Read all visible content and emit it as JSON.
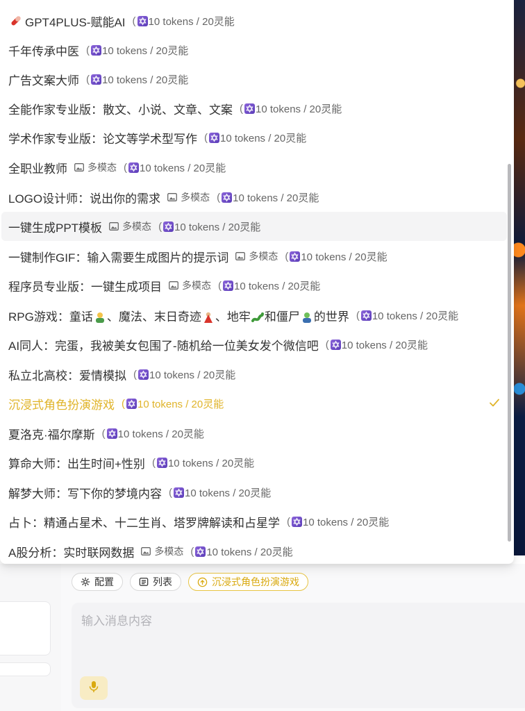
{
  "menu": {
    "items": [
      {
        "name": "GPT4PLUS-赋能AI",
        "lead_icon": "pill-icon",
        "multimodal": false,
        "tokens": "10 tokens / 20灵能"
      },
      {
        "name": "千年传承中医",
        "multimodal": false,
        "tokens": "10 tokens / 20灵能"
      },
      {
        "name": "广告文案大师",
        "multimodal": false,
        "tokens": "10 tokens / 20灵能"
      },
      {
        "name": "全能作家专业版：散文、小说、文章、文案",
        "multimodal": false,
        "tokens": "10 tokens / 20灵能"
      },
      {
        "name": "学术作家专业版：论文等学术型写作",
        "multimodal": false,
        "tokens": "10 tokens / 20灵能"
      },
      {
        "name": "全职业教师",
        "multimodal": true,
        "tokens": "10 tokens / 20灵能"
      },
      {
        "name": "LOGO设计师：说出你的需求",
        "multimodal": true,
        "tokens": "10 tokens / 20灵能"
      },
      {
        "name": "一键生成PPT模板",
        "multimodal": true,
        "tokens": "10 tokens / 20灵能",
        "hovered": true
      },
      {
        "name": "一键制作GIF：输入需要生成图片的提示词",
        "multimodal": true,
        "tokens": "10 tokens / 20灵能"
      },
      {
        "name": "程序员专业版：一键生成项目",
        "multimodal": true,
        "tokens": "10 tokens / 20灵能"
      },
      {
        "name": "RPG游戏：童话",
        "name_parts": [
          "、魔法、末日奇迹",
          "、地牢",
          "和僵尸",
          "的世界"
        ],
        "multimodal": false,
        "tokens": "10 tokens / 20灵能"
      },
      {
        "name": "AI同人：完蛋，我被美女包围了-随机给一位美女发个微信吧",
        "multimodal": false,
        "tokens": "10 tokens / 20灵能"
      },
      {
        "name": "私立北高校：爱情模拟",
        "multimodal": false,
        "tokens": "10 tokens / 20灵能"
      },
      {
        "name": "沉浸式角色扮演游戏",
        "multimodal": false,
        "tokens": "10 tokens / 20灵能",
        "selected": true
      },
      {
        "name": "夏洛克·福尔摩斯",
        "multimodal": false,
        "tokens": "10 tokens / 20灵能"
      },
      {
        "name": "算命大师：出生时间+性别",
        "multimodal": false,
        "tokens": "10 tokens / 20灵能"
      },
      {
        "name": "解梦大师：写下你的梦境内容",
        "multimodal": false,
        "tokens": "10 tokens / 20灵能"
      },
      {
        "name": "占卜：精通占星术、十二生肖、塔罗牌解读和占星学",
        "multimodal": false,
        "tokens": "10 tokens / 20灵能"
      },
      {
        "name": "A股分析：实时联网数据",
        "multimodal": true,
        "tokens": "10 tokens / 20灵能"
      }
    ],
    "multimodal_label": "多模态",
    "paren_open": "("
  },
  "toolbar": {
    "config_label": "配置",
    "list_label": "列表",
    "model_label": "沉浸式角色扮演游戏"
  },
  "composer": {
    "placeholder": "输入消息内容"
  },
  "colors": {
    "accent": "#e0b42a",
    "token_badge": "#6a48c9"
  }
}
